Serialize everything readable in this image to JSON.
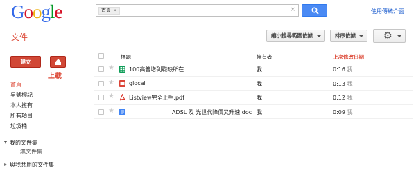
{
  "header": {
    "logo_letters": [
      {
        "ch": "G",
        "color": "#3369e8"
      },
      {
        "ch": "o",
        "color": "#d50f25"
      },
      {
        "ch": "o",
        "color": "#eeb211"
      },
      {
        "ch": "g",
        "color": "#3369e8"
      },
      {
        "ch": "l",
        "color": "#009925"
      },
      {
        "ch": "e",
        "color": "#d50f25"
      }
    ],
    "search_chip": "首頁",
    "search_chip_remove": "×",
    "search_clear": "×",
    "classic_link": "使用傳統介面"
  },
  "toolbar": {
    "title": "文件",
    "narrow_search_btn": "縮小搜尋範圍依據",
    "sort_btn": "排序依據",
    "settings_icon": "gear-icon"
  },
  "sidebar": {
    "create_label": "建立",
    "upload_label": "上載",
    "nav": [
      "首頁",
      "星號標記",
      "本人擁有",
      "所有項目",
      "垃圾桶"
    ],
    "active_index": 0,
    "my_collections": "我的文件集",
    "no_collections": "無文件集",
    "shared_collections": "與我共用的文件集"
  },
  "list": {
    "headers": {
      "title": "標題",
      "owner": "擁有者",
      "modified": "上次修改日期"
    },
    "rows": [
      {
        "icon": "spreadsheet-icon",
        "name": "100高普增列職缺所在",
        "owner": "我",
        "time": "0:16",
        "by": "我"
      },
      {
        "icon": "presentation-icon",
        "name": "glocal",
        "owner": "我",
        "time": "0:13",
        "by": "我"
      },
      {
        "icon": "pdf-icon",
        "name": "Listview完全上手.pdf",
        "owner": "我",
        "time": "0:12",
        "by": "我"
      },
      {
        "icon": "document-icon",
        "name": "ADSL 及 光世代降價又升速.doc",
        "owner": "我",
        "time": "0:09",
        "by": "我"
      }
    ]
  },
  "colors": {
    "accent_red": "#dd4b39",
    "search_blue": "#4a8af4",
    "link_blue": "#1155cc"
  }
}
